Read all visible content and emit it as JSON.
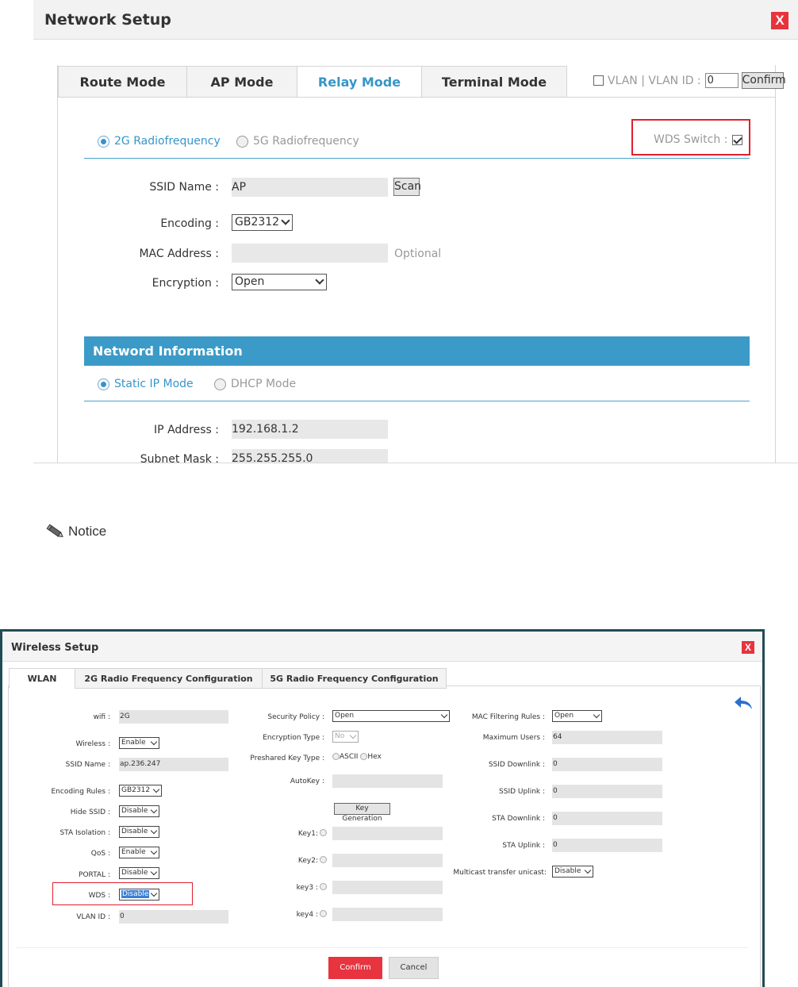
{
  "network_setup": {
    "title": "Network Setup",
    "close": "X",
    "tabs": [
      "Route Mode",
      "AP Mode",
      "Relay Mode",
      "Terminal Mode"
    ],
    "active_tab": "Relay Mode",
    "vlan": {
      "label": "VLAN | VLAN ID :",
      "value": "0",
      "confirm": "Confirm"
    },
    "radio_2g": "2G Radiofrequency",
    "radio_5g": "5G Radiofrequency",
    "wds_switch": {
      "label": "WDS Switch :",
      "checked": true
    },
    "ssid_label": "SSID Name :",
    "ssid_value": "AP",
    "scan": "Scan",
    "encoding_label": "Encoding :",
    "encoding_value": "GB2312",
    "mac_label": "MAC Address :",
    "mac_value": "",
    "mac_hint": "Optional",
    "encryption_label": "Encryption :",
    "encryption_value": "Open",
    "section_title": "Netword Information",
    "static_ip": "Static IP Mode",
    "dhcp": "DHCP Mode",
    "ip_label": "IP Address :",
    "ip_value": "192.168.1.2",
    "mask_label": "Subnet Mask :",
    "mask_value": "255.255.255.0"
  },
  "notice": {
    "text": "Notice",
    "icon": "pencil-icon"
  },
  "wireless_setup": {
    "title": "Wireless Setup",
    "close": "X",
    "tabs": [
      "WLAN",
      "2G Radio Frequency Configuration",
      "5G Radio Frequency Configuration"
    ],
    "active_tab": "WLAN",
    "col1": {
      "wifi_label": "wifi :",
      "wifi_value": "2G",
      "wireless_label": "Wireless :",
      "wireless_value": "Enable",
      "ssid_label": "SSID Name :",
      "ssid_value": "ap.236.247",
      "encoding_label": "Encoding Rules :",
      "encoding_value": "GB2312",
      "hide_ssid_label": "Hide SSID :",
      "hide_ssid_value": "Disable",
      "sta_isolation_label": "STA Isolation :",
      "sta_isolation_value": "Disable",
      "qos_label": "QoS :",
      "qos_value": "Enable",
      "portal_label": "PORTAL :",
      "portal_value": "Disable",
      "wds_label": "WDS :",
      "wds_value": "Disable",
      "vlan_label": "VLAN ID :",
      "vlan_value": "0"
    },
    "col2": {
      "security_label": "Security Policy :",
      "security_value": "Open",
      "enc_type_label": "Encryption Type :",
      "enc_type_value": "No",
      "psk_type_label": "Preshared Key Type :",
      "psk_ascii": "ASCII",
      "psk_hex": "Hex",
      "autokey_label": "AutoKey :",
      "keygen": "Key Generation",
      "key1_label": "Key1:",
      "key2_label": "Key2:",
      "key3_label": "key3 :",
      "key4_label": "key4 :"
    },
    "col3": {
      "mac_filter_label": "MAC Filtering Rules :",
      "mac_filter_value": "Open",
      "max_users_label": "Maximum Users :",
      "max_users_value": "64",
      "ssid_down_label": "SSID Downlink :",
      "ssid_down_value": "0",
      "ssid_up_label": "SSID Uplink :",
      "ssid_up_value": "0",
      "sta_down_label": "STA Downlink :",
      "sta_down_value": "0",
      "sta_up_label": "STA Uplink :",
      "sta_up_value": "0",
      "multicast_label": "Multicast transfer unicast:",
      "multicast_value": "Disable"
    },
    "confirm": "Confirm",
    "cancel": "Cancel"
  },
  "colors": {
    "accent_blue": "#3795c8",
    "band_blue": "#3b9ac7",
    "red": "#e8333d",
    "frame_dark": "#224b55"
  }
}
